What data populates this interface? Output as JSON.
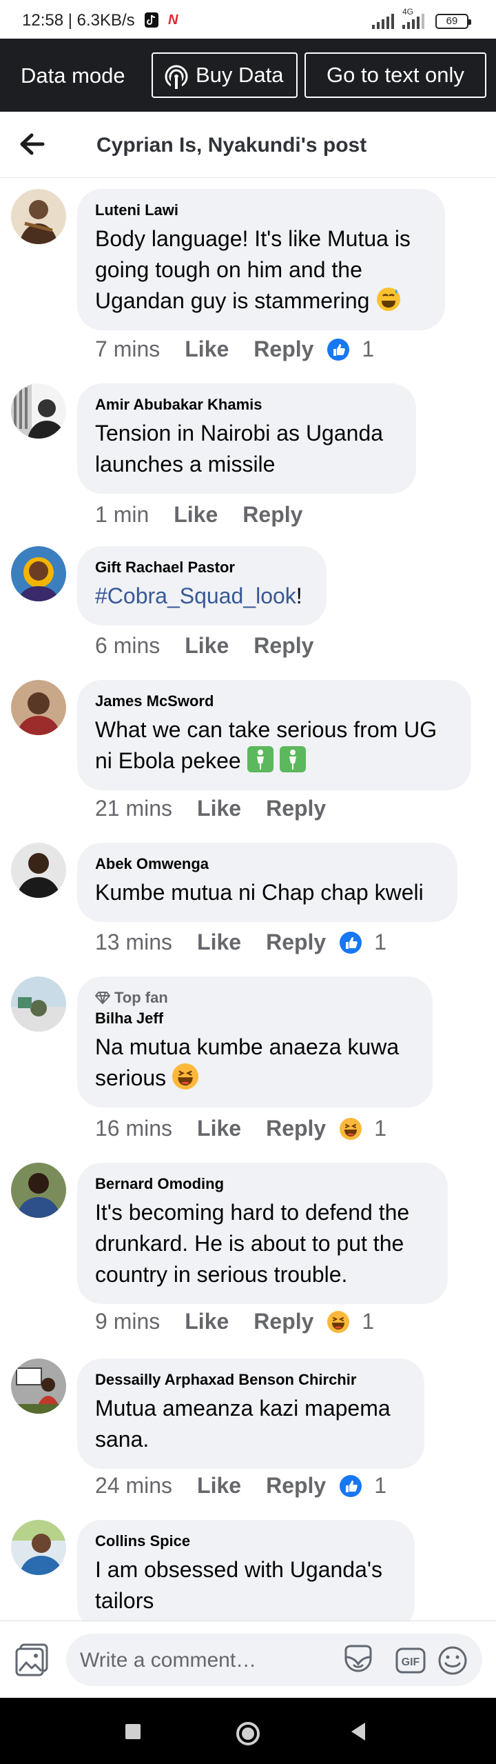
{
  "status": {
    "time": "12:58 | 6.3KB/s",
    "network": "4G",
    "battery": "69"
  },
  "databar": {
    "mode": "Data mode",
    "buy": "Buy Data",
    "text_only": "Go to text only"
  },
  "header": {
    "title": "Cyprian Is, Nyakundi's post"
  },
  "labels": {
    "like": "Like",
    "reply": "Reply",
    "top_fan": "Top fan"
  },
  "comments": [
    {
      "name": "Luteni Lawi",
      "text": "Body language! It's like Mutua is going tough on him and the Ugandan guy is stammering",
      "time": "7 mins",
      "reaction": "like",
      "count": "1"
    },
    {
      "name": "Amir Abubakar Khamis",
      "text": "Tension in Nairobi as Uganda launches a missile",
      "time": "1 min"
    },
    {
      "name": "Gift Rachael Pastor",
      "text_tag": "#Cobra_Squad_look",
      "text_after": "!",
      "time": "6 mins"
    },
    {
      "name": "James McSword",
      "text": "What we can take serious from UG ni Ebola pekee",
      "time": "21 mins"
    },
    {
      "name": "Abek Omwenga",
      "text": "Kumbe mutua ni Chap chap kweli",
      "time": "13 mins",
      "reaction": "like",
      "count": "1"
    },
    {
      "name": "Bilha Jeff",
      "text": "Na mutua kumbe anaeza kuwa serious",
      "time": "16 mins",
      "reaction": "haha",
      "count": "1"
    },
    {
      "name": "Bernard Omoding",
      "text": "It's becoming hard to defend the drunkard. He is about to put the country in serious trouble.",
      "time": "9 mins",
      "reaction": "haha",
      "count": "1"
    },
    {
      "name": "Dessailly Arphaxad Benson Chirchir",
      "text": "Mutua ameanza kazi mapema sana.",
      "time": "24 mins",
      "reaction": "like",
      "count": "1"
    },
    {
      "name": "Collins Spice",
      "text": "I am obsessed with Uganda's tailors"
    }
  ],
  "composer": {
    "placeholder": "Write a comment…",
    "gif": "GIF"
  },
  "icons": {
    "back": "arrow-left-icon",
    "buy": "broadcast-icon",
    "like": "thumbs-up-icon",
    "haha": "laughing-emoji-icon",
    "photo": "photo-icon",
    "sticker": "sticker-icon",
    "smile": "smiley-icon",
    "diamond": "diamond-icon"
  },
  "colors": {
    "accent": "#1877f2",
    "link": "#385898",
    "bubble": "#f0f2f5",
    "databar": "#1c1e21"
  }
}
